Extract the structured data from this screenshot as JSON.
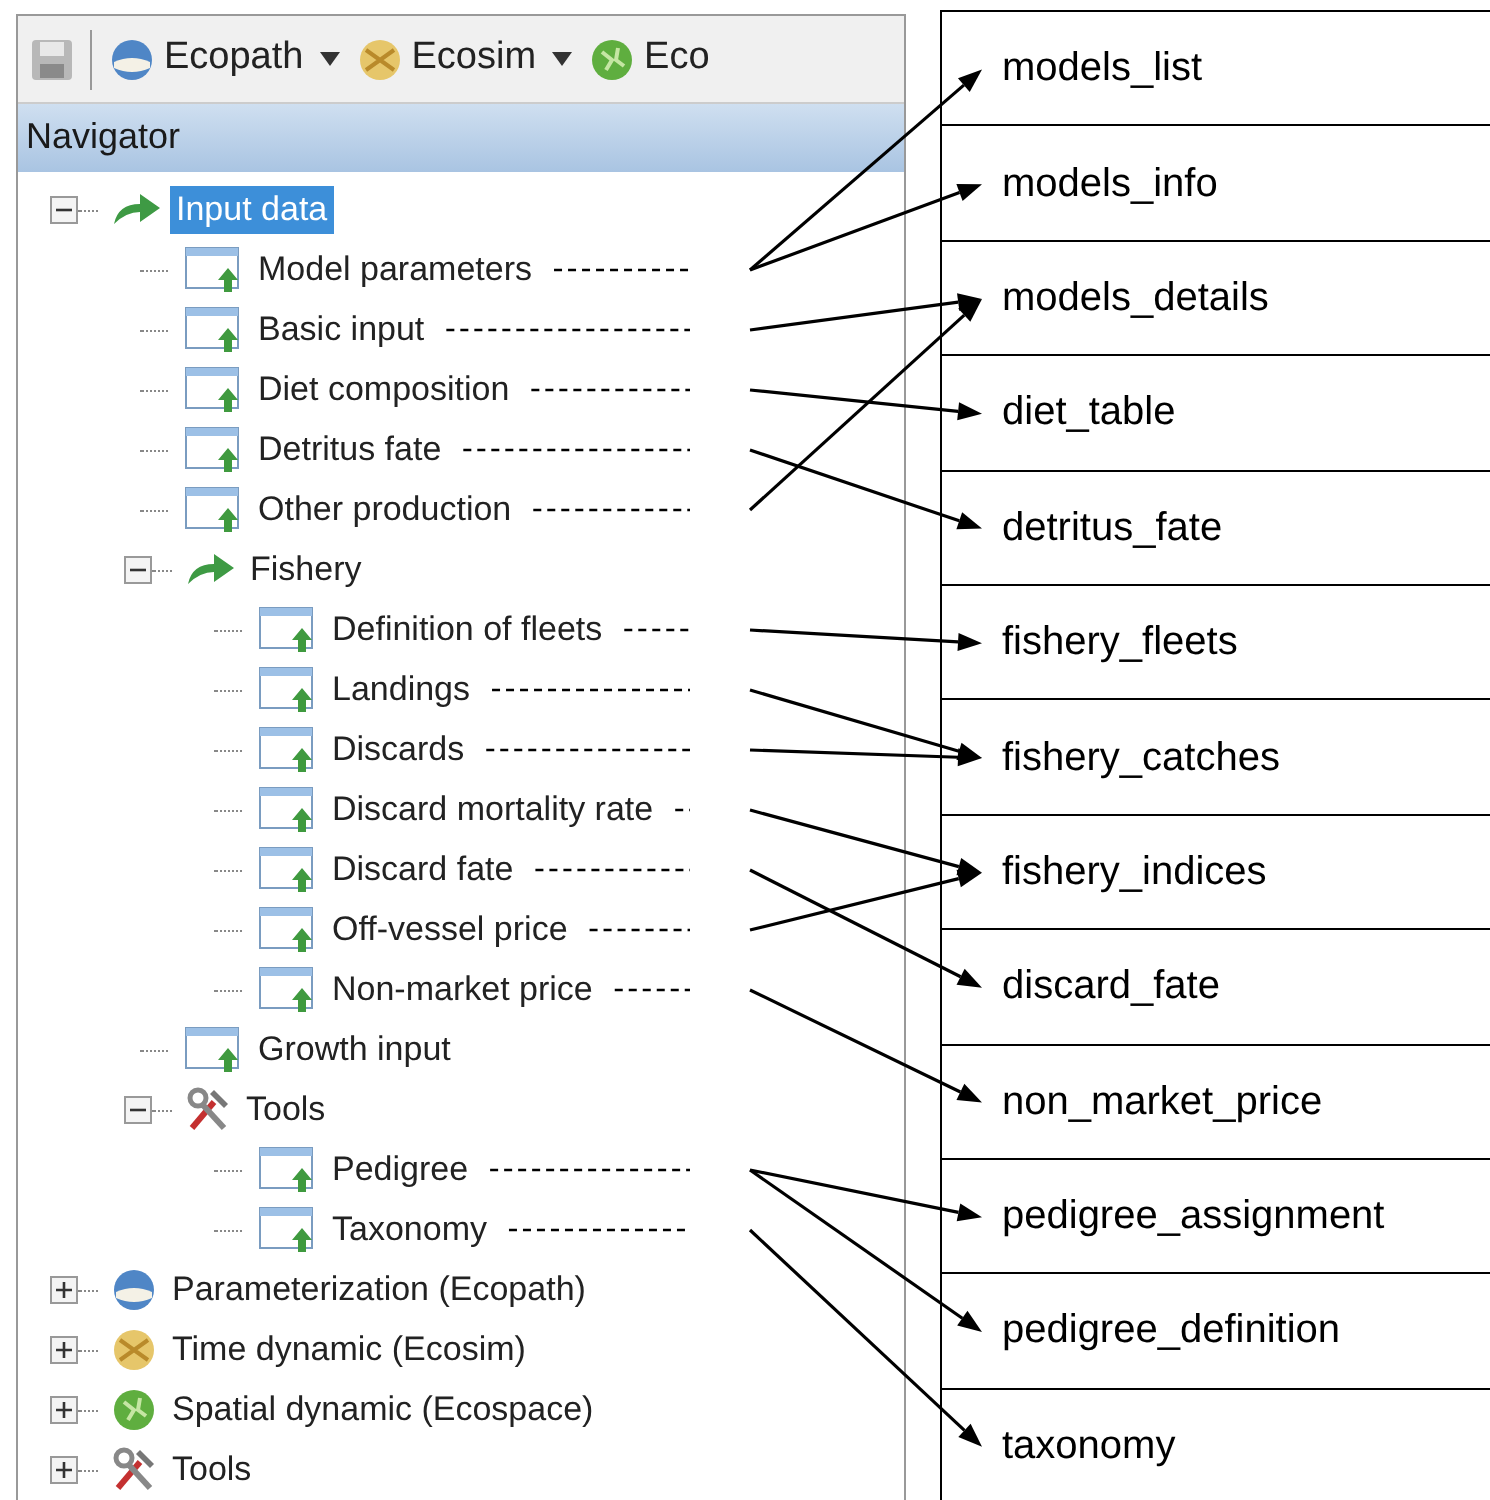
{
  "toolbar": {
    "items": [
      {
        "kind": "save"
      },
      {
        "kind": "globe-blue",
        "label": "Ecopath",
        "dropdown": true
      },
      {
        "kind": "globe-sun",
        "label": "Ecosim",
        "dropdown": true
      },
      {
        "kind": "globe-green",
        "label": "Eco",
        "dropdown": false
      }
    ]
  },
  "navigator": {
    "title": "Navigator",
    "tree": [
      {
        "label": "Input data",
        "kind": "arrow",
        "selected": true,
        "expanded": true,
        "children": [
          {
            "label": "Model parameters",
            "kind": "page",
            "selected": false,
            "arrow_to": {
              "row_0": true,
              "row_1": true
            }
          },
          {
            "label": "Basic input",
            "kind": "page",
            "selected": false,
            "arrow_to": {
              "row_2": true
            }
          },
          {
            "label": "Diet composition",
            "kind": "page",
            "selected": false,
            "arrow_to": {
              "row_3": true
            }
          },
          {
            "label": "Detritus fate",
            "kind": "page",
            "selected": false,
            "arrow_to": {
              "row_4": true
            }
          },
          {
            "label": "Other production",
            "kind": "page",
            "selected": false,
            "arrow_to": {
              "row_2": true
            }
          },
          {
            "label": "Fishery",
            "kind": "arrow",
            "selected": false,
            "expanded": true,
            "children": [
              {
                "label": "Definition of fleets",
                "kind": "page",
                "selected": false,
                "arrow_to": {
                  "row_5": true
                }
              },
              {
                "label": "Landings",
                "kind": "page",
                "selected": false,
                "arrow_to": {
                  "row_6": true
                }
              },
              {
                "label": "Discards",
                "kind": "page",
                "selected": false,
                "arrow_to": {
                  "row_6": true
                }
              },
              {
                "label": "Discard mortality rate",
                "kind": "page",
                "selected": false,
                "arrow_to": {
                  "row_7": true
                }
              },
              {
                "label": "Discard fate",
                "kind": "page",
                "selected": false,
                "arrow_to": {
                  "row_8": true
                }
              },
              {
                "label": "Off-vessel price",
                "kind": "page",
                "selected": false,
                "arrow_to": {
                  "row_7": true
                }
              },
              {
                "label": "Non-market price",
                "kind": "page",
                "selected": false,
                "arrow_to": {
                  "row_9": true
                }
              }
            ]
          },
          {
            "label": "Growth input",
            "kind": "page",
            "selected": false
          },
          {
            "label": "Tools",
            "kind": "tools",
            "selected": false,
            "expanded": true,
            "children": [
              {
                "label": "Pedigree",
                "kind": "page",
                "selected": false,
                "arrow_to": {
                  "row_10": true,
                  "row_11": true
                }
              },
              {
                "label": "Taxonomy",
                "kind": "page",
                "selected": false,
                "arrow_to": {
                  "row_12": true
                }
              }
            ]
          }
        ]
      },
      {
        "label": "Parameterization (Ecopath)",
        "kind": "globe-blue",
        "selected": false,
        "expanded": false
      },
      {
        "label": "Time dynamic (Ecosim)",
        "kind": "globe-sun",
        "selected": false,
        "expanded": false
      },
      {
        "label": "Spatial dynamic  (Ecospace)",
        "kind": "globe-green",
        "selected": false,
        "expanded": false
      },
      {
        "label": "Tools",
        "kind": "tools",
        "selected": false,
        "expanded": false
      }
    ]
  },
  "targets_table": {
    "rows": [
      "models_list",
      "models_info",
      "models_details",
      "diet_table",
      "detritus_fate",
      "fishery_fleets",
      "fishery_catches",
      "fishery_indices",
      "discard_fate",
      "non_market_price",
      "pedigree_assignment",
      "pedigree_definition",
      "taxonomy"
    ]
  }
}
